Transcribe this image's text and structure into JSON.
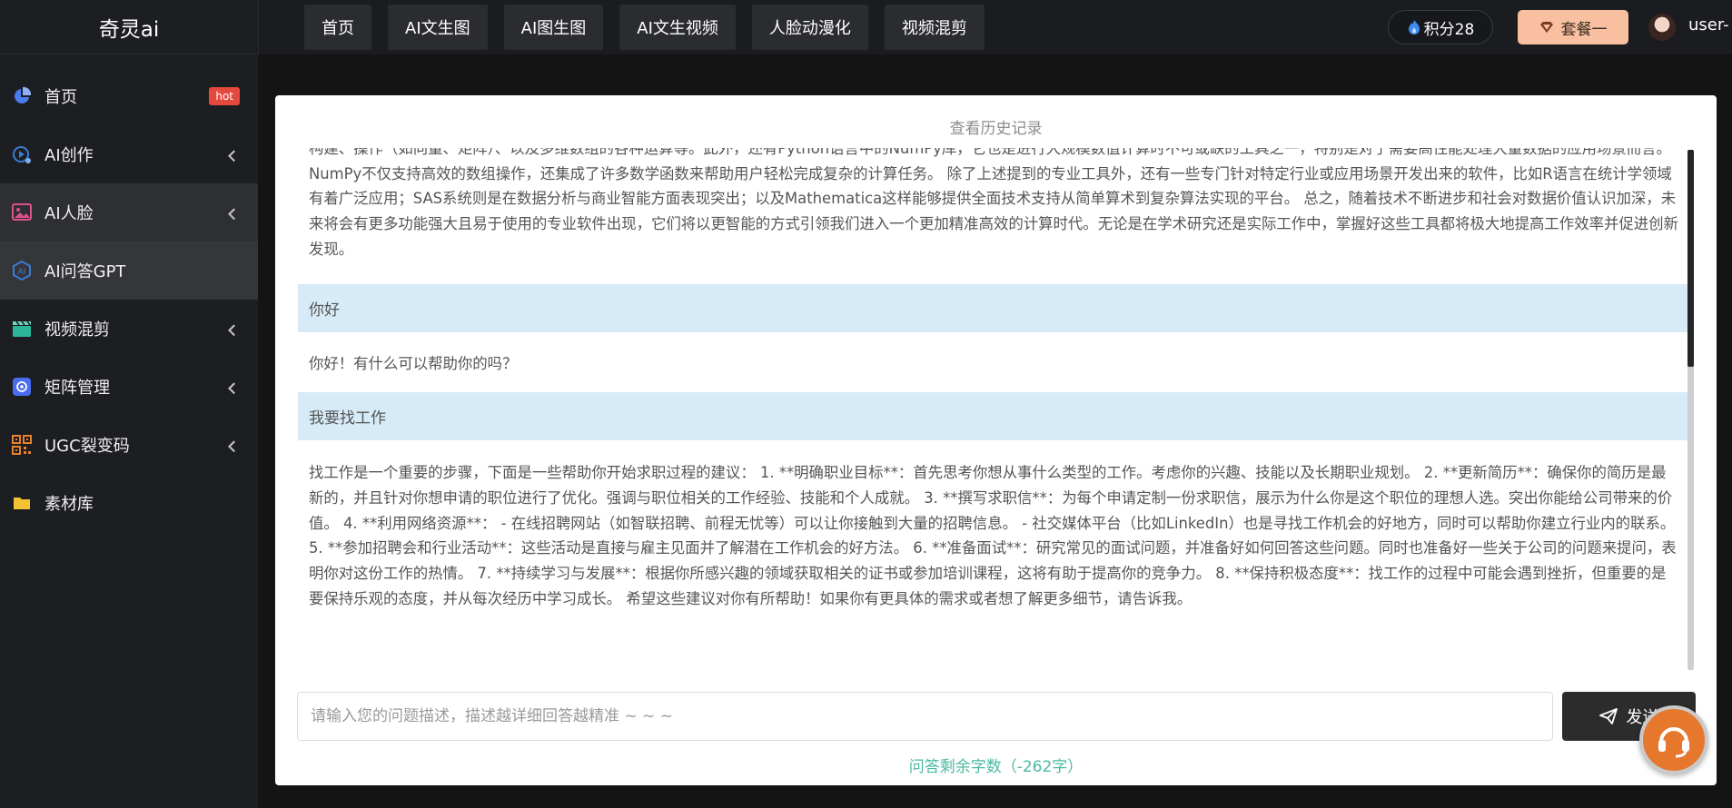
{
  "app": {
    "logo": "奇灵ai"
  },
  "sidebar": {
    "items": [
      {
        "label": "首页",
        "badge": "hot",
        "icon": "pie-chart-icon",
        "color": "#4a7df0"
      },
      {
        "label": "AI创作",
        "icon": "ai-create-icon",
        "color": "#3a7bd5"
      },
      {
        "label": "AI人脸",
        "icon": "face-image-icon",
        "color": "#e0508a"
      },
      {
        "label": "AI问答GPT",
        "icon": "ai-chat-icon",
        "color": "#3a7bd5"
      },
      {
        "label": "视频混剪",
        "icon": "clapperboard-icon",
        "color": "#2cb59b"
      },
      {
        "label": "矩阵管理",
        "icon": "matrix-icon",
        "color": "#4a6cf0"
      },
      {
        "label": "UGC裂变码",
        "icon": "qr-code-icon",
        "color": "#e8822c"
      },
      {
        "label": "素材库",
        "icon": "folder-icon",
        "color": "#f2c232"
      }
    ]
  },
  "topbar": {
    "tabs": [
      "首页",
      "AI文生图",
      "AI图生图",
      "AI文生视频",
      "人脸动漫化",
      "视频混剪"
    ],
    "points": "积分28",
    "plan": "套餐一",
    "username": "user-"
  },
  "main": {
    "history_link": "查看历史记录",
    "messages": [
      {
        "role": "assistant",
        "text": "构建、操作（如向量、矩阵）、以及多维数组的各种运算等。此外，还有Python语言中的NumPy库，它也是进行大规模数值计算时不可或缺的工具之一，特别是对于需要高性能处理大量数据的应用场景而言。NumPy不仅支持高效的数组操作，还集成了许多数学函数来帮助用户轻松完成复杂的计算任务。 除了上述提到的专业工具外，还有一些专门针对特定行业或应用场景开发出来的软件，比如R语言在统计学领域有着广泛应用；SAS系统则是在数据分析与商业智能方面表现突出；以及Mathematica这样能够提供全面技术支持从简单算术到复杂算法实现的平台。 总之，随着技术不断进步和社会对数据价值认识加深，未来将会有更多功能强大且易于使用的专业软件出现，它们将以更智能的方式引领我们进入一个更加精准高效的计算时代。无论是在学术研究还是实际工作中，掌握好这些工具都将极大地提高工作效率并促进创新发现。"
      },
      {
        "role": "user",
        "text": "你好"
      },
      {
        "role": "assistant",
        "text": "你好！有什么可以帮助你的吗？"
      },
      {
        "role": "user",
        "text": "我要找工作"
      },
      {
        "role": "assistant",
        "text": "找工作是一个重要的步骤，下面是一些帮助你开始求职过程的建议： 1. **明确职业目标**：首先思考你想从事什么类型的工作。考虑你的兴趣、技能以及长期职业规划。 2. **更新简历**：确保你的简历是最新的，并且针对你想申请的职位进行了优化。强调与职位相关的工作经验、技能和个人成就。 3. **撰写求职信**：为每个申请定制一份求职信，展示为什么你是这个职位的理想人选。突出你能给公司带来的价值。 4. **利用网络资源**： - 在线招聘网站（如智联招聘、前程无忧等）可以让你接触到大量的招聘信息。 - 社交媒体平台（比如LinkedIn）也是寻找工作机会的好地方，同时可以帮助你建立行业内的联系。 5. **参加招聘会和行业活动**：这些活动是直接与雇主见面并了解潜在工作机会的好方法。 6. **准备面试**：研究常见的面试问题，并准备好如何回答这些问题。同时也准备好一些关于公司的问题来提问，表明你对这份工作的热情。 7. **持续学习与发展**：根据你所感兴趣的领域获取相关的证书或参加培训课程，这将有助于提高你的竞争力。 8. **保持积极态度**：找工作的过程中可能会遇到挫折，但重要的是要保持乐观的态度，并从每次经历中学习成长。 希望这些建议对你有所帮助！如果你有更具体的需求或者想了解更多细节，请告诉我。"
      }
    ],
    "input": {
      "placeholder": "请输入您的问题描述，描述越详细回答越精准 ~ ~ ~",
      "value": ""
    },
    "send_label": "发送",
    "remaining": "问答剩余字数（-262字）"
  },
  "colors": {
    "accent": "#4ab9a3",
    "user_bubble": "#d6ebf7",
    "plan_button": "#f8bfa0",
    "hot_badge": "#e5483d"
  }
}
